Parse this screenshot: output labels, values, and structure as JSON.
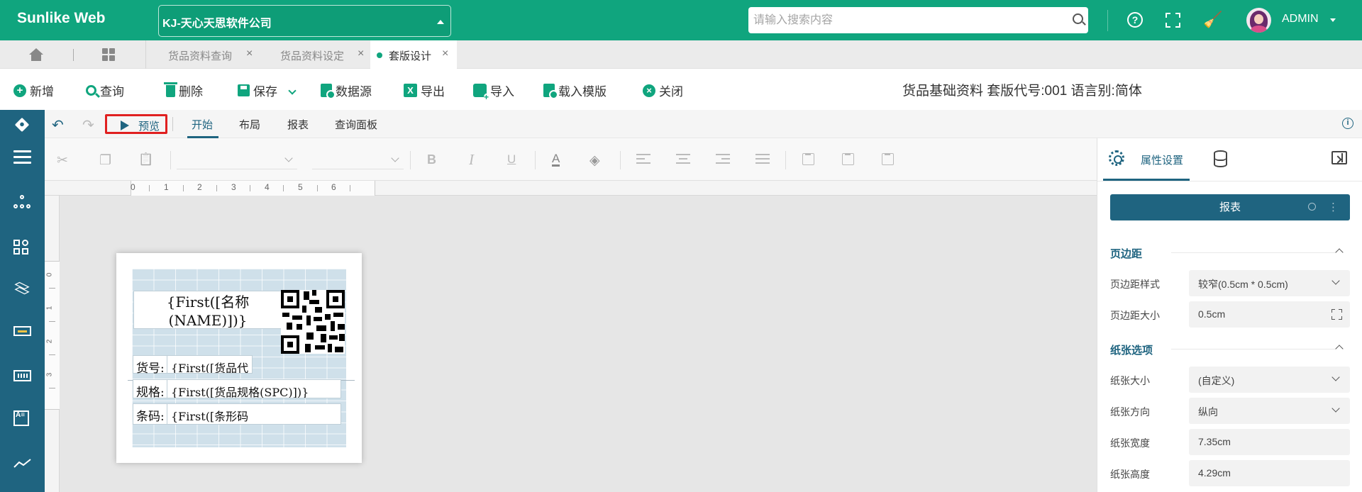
{
  "header": {
    "brand": "Sunlike Web",
    "company": "KJ-天心天思软件公司",
    "search_placeholder": "请输入搜索内容",
    "help_glyph": "?",
    "broom_glyph": "🧹",
    "user": "ADMIN",
    "accent_color": "#10a57e"
  },
  "tabs": [
    {
      "label": "货品资料查询",
      "active": false
    },
    {
      "label": "货品资料设定",
      "active": false
    },
    {
      "label": "套版设计",
      "active": true
    }
  ],
  "tab_close_glyph": "×",
  "toolbar": {
    "new": "新增",
    "query": "查询",
    "delete": "删除",
    "save": "保存",
    "datasource": "数据源",
    "export": "导出",
    "import": "导入",
    "load_template": "载入模版",
    "close": "关闭",
    "plus_glyph": "+",
    "xls_glyph": "X",
    "close_glyph": "×",
    "doc_info": "货品基础资料 套版代号:001 语言别:简体"
  },
  "designer": {
    "undo_glyph": "↶",
    "redo_glyph": "↷",
    "preview": "预览",
    "tabs": [
      "开始",
      "布局",
      "报表",
      "查询面板"
    ],
    "active_tab": "开始",
    "info_glyph": "i",
    "primary_color": "#1f6480",
    "format_glyphs": {
      "cut": "✂",
      "copy": "❐",
      "paste": "📋",
      "bold": "B",
      "italic": "I",
      "underline": "U",
      "font_color": "A",
      "fill": "◈"
    }
  },
  "rulers": {
    "horizontal": [
      "0",
      "1",
      "2",
      "3",
      "4",
      "5",
      "6"
    ],
    "vertical": [
      "0",
      "1",
      "2",
      "3"
    ]
  },
  "label": {
    "title": "{First([名称(NAME)])}",
    "rows": [
      {
        "key": "货号:",
        "value": "{First([货品代"
      },
      {
        "key": "规格:",
        "value": "{First([货品规格(SPC)])}"
      },
      {
        "key": "条码:",
        "value": "{First([条形码"
      }
    ]
  },
  "properties": {
    "tab_label": "属性设置",
    "report_select": "报表",
    "more_glyph": "⋮",
    "sections": [
      {
        "title": "页边距",
        "fields": [
          {
            "label": "页边距样式",
            "value": "较窄(0.5cm * 0.5cm)",
            "kind": "select"
          },
          {
            "label": "页边距大小",
            "value": "0.5cm",
            "kind": "expand"
          }
        ]
      },
      {
        "title": "纸张选项",
        "fields": [
          {
            "label": "纸张大小",
            "value": "(自定义)",
            "kind": "select"
          },
          {
            "label": "纸张方向",
            "value": "纵向",
            "kind": "select"
          },
          {
            "label": "纸张宽度",
            "value": "7.35cm",
            "kind": "text"
          },
          {
            "label": "纸张高度",
            "value": "4.29cm",
            "kind": "text"
          }
        ]
      }
    ]
  }
}
